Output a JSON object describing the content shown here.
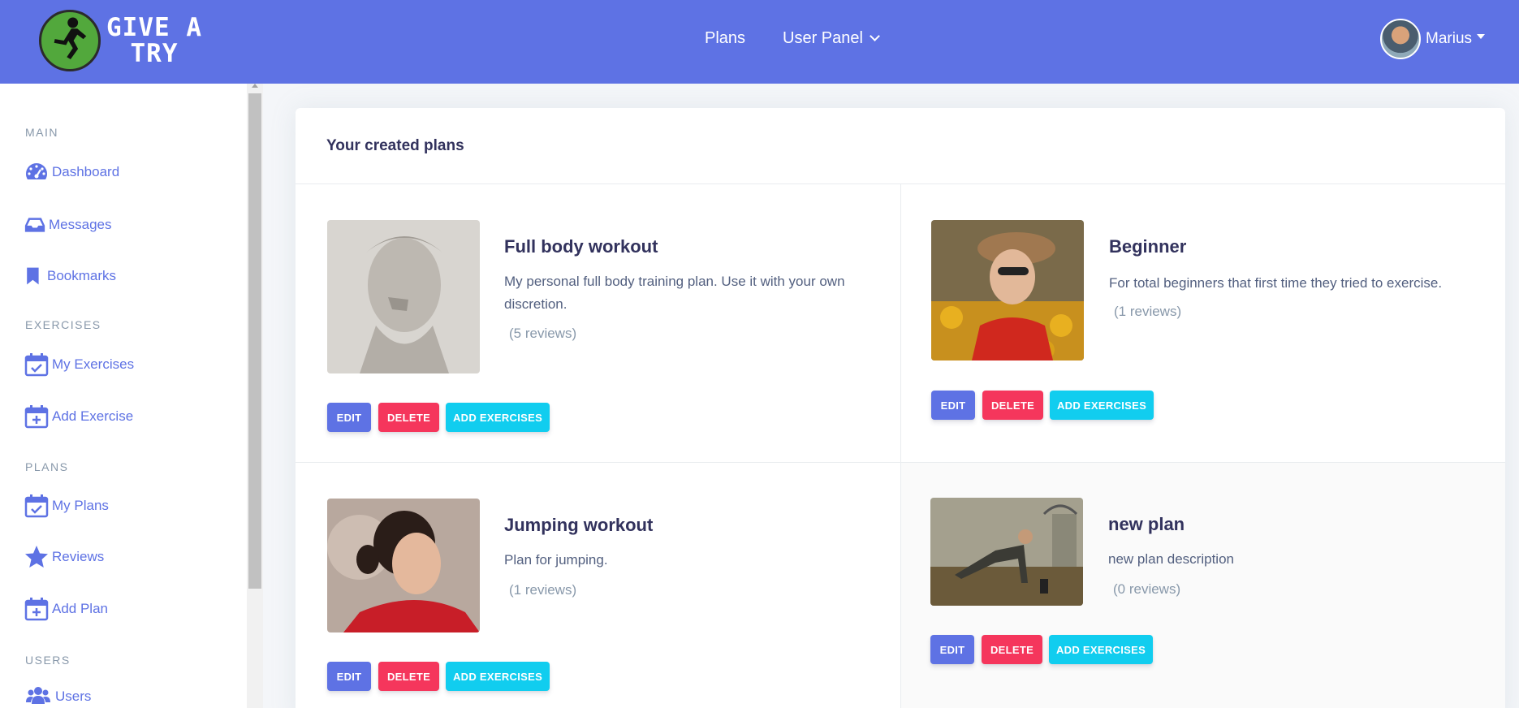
{
  "brand": {
    "logo_text": "GIVE A\nTRY",
    "logo_color": "#52a83c"
  },
  "nav": {
    "plans_label": "Plans",
    "user_panel_label": "User Panel"
  },
  "user": {
    "name": "Marius"
  },
  "sidebar": {
    "sections": [
      {
        "label": "MAIN",
        "items": [
          {
            "label": "Dashboard",
            "icon": "dashboard-icon"
          },
          {
            "label": "Messages",
            "icon": "inbox-icon"
          },
          {
            "label": "Bookmarks",
            "icon": "bookmark-icon"
          }
        ]
      },
      {
        "label": "EXERCISES",
        "items": [
          {
            "label": "My Exercises",
            "icon": "calendar-check-icon"
          },
          {
            "label": "Add Exercise",
            "icon": "calendar-plus-icon"
          }
        ]
      },
      {
        "label": "PLANS",
        "items": [
          {
            "label": "My Plans",
            "icon": "calendar-check-icon"
          },
          {
            "label": "Reviews",
            "icon": "star-icon"
          },
          {
            "label": "Add Plan",
            "icon": "calendar-plus-icon"
          }
        ]
      },
      {
        "label": "USERS",
        "items": [
          {
            "label": "Users",
            "icon": "users-icon"
          }
        ]
      }
    ]
  },
  "main": {
    "title": "Your created plans",
    "buttons": {
      "edit": "EDIT",
      "delete": "DELETE",
      "add": "ADD EXERCISES"
    },
    "plans": [
      {
        "title": "Full body workout",
        "description": "My personal full body training plan. Use it with your own discretion.",
        "reviews": "(5 reviews)"
      },
      {
        "title": "Beginner",
        "description": "For total beginners that first time they tried to exercise.",
        "reviews": "(1 reviews)"
      },
      {
        "title": "Jumping workout",
        "description": "Plan for jumping.",
        "reviews": "(1 reviews)"
      },
      {
        "title": "new plan",
        "description": "new plan description",
        "reviews": "(0 reviews)"
      }
    ]
  },
  "colors": {
    "primary": "#5e72e4",
    "danger": "#f5365c",
    "info": "#11cdef"
  }
}
